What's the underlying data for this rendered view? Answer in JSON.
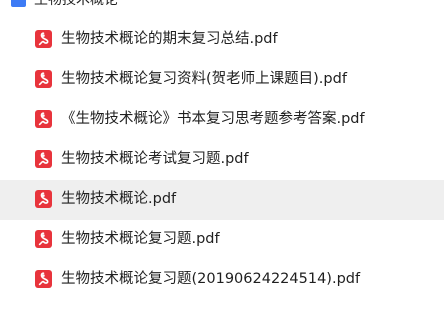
{
  "folder": {
    "name": "生物技术概论",
    "icon": "folder-icon"
  },
  "files": [
    {
      "name": "生物技术概论的期末复习总结.pdf",
      "icon": "pdf-icon",
      "selected": false
    },
    {
      "name": "生物技术概论复习资料(贺老师上课题目).pdf",
      "icon": "pdf-icon",
      "selected": false
    },
    {
      "name": "《生物技术概论》书本复习思考题参考答案.pdf",
      "icon": "pdf-icon",
      "selected": false
    },
    {
      "name": "生物技术概论考试复习题.pdf",
      "icon": "pdf-icon",
      "selected": false
    },
    {
      "name": "生物技术概论.pdf",
      "icon": "pdf-icon",
      "selected": true
    },
    {
      "name": "生物技术概论复习题.pdf",
      "icon": "pdf-icon",
      "selected": false
    },
    {
      "name": "生物技术概论复习题(20190624224514).pdf",
      "icon": "pdf-icon",
      "selected": false
    }
  ],
  "colors": {
    "pdf_icon": "#e8343c",
    "folder_icon": "#3d7bf5",
    "selected_row": "#efefef"
  }
}
